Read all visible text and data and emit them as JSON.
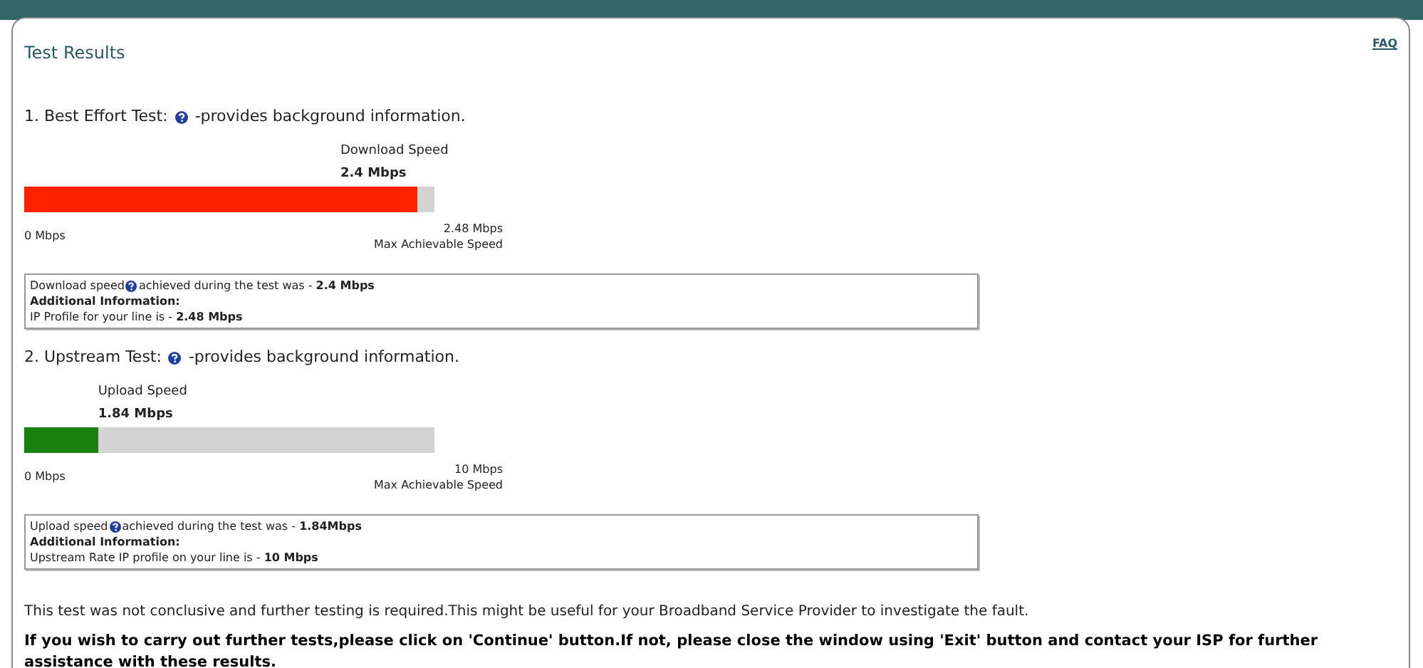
{
  "faq_link": "FAQ",
  "title": "Test Results",
  "tests": [
    {
      "heading_before_icon": "1. Best Effort Test:",
      "heading_after_icon": "-provides background information.",
      "speed_label": "Download Speed",
      "speed_value": "2.4 Mbps",
      "level": 0.96,
      "color": "#ff2200",
      "min_label": "0 Mbps",
      "max_value": "2.48 Mbps",
      "max_label": "Max Achievable Speed",
      "info_before_icon": "Download speed",
      "info_after_icon": "achieved during the test was - **2.4 Mbps**",
      "info_heading": "Additional Information:",
      "info_detail": "IP Profile for your line is - **2.48 Mbps**"
    },
    {
      "heading_before_icon": "2. Upstream Test:",
      "heading_after_icon": "-provides background information.",
      "speed_label": "Upload Speed",
      "speed_value": "1.84 Mbps",
      "level": 0.18,
      "color": "#1a8010",
      "min_label": "0 Mbps",
      "max_value": "10 Mbps",
      "max_label": "Max Achievable Speed",
      "info_before_icon": "Upload speed",
      "info_after_icon": " achieved during the test was - **1.84Mbps**",
      "info_heading": "Additional Information:",
      "info_detail": "Upstream Rate IP profile on your line is - **10 Mbps**"
    }
  ],
  "message": "This test was not conclusive and further testing is required.This might be useful for your Broadband Service Provider to investigate the fault.",
  "instruction": "If you wish to carry out further tests,please click on 'Continue' button.If not, please close the window using 'Exit' button and contact your ISP for further assistance with these results."
}
